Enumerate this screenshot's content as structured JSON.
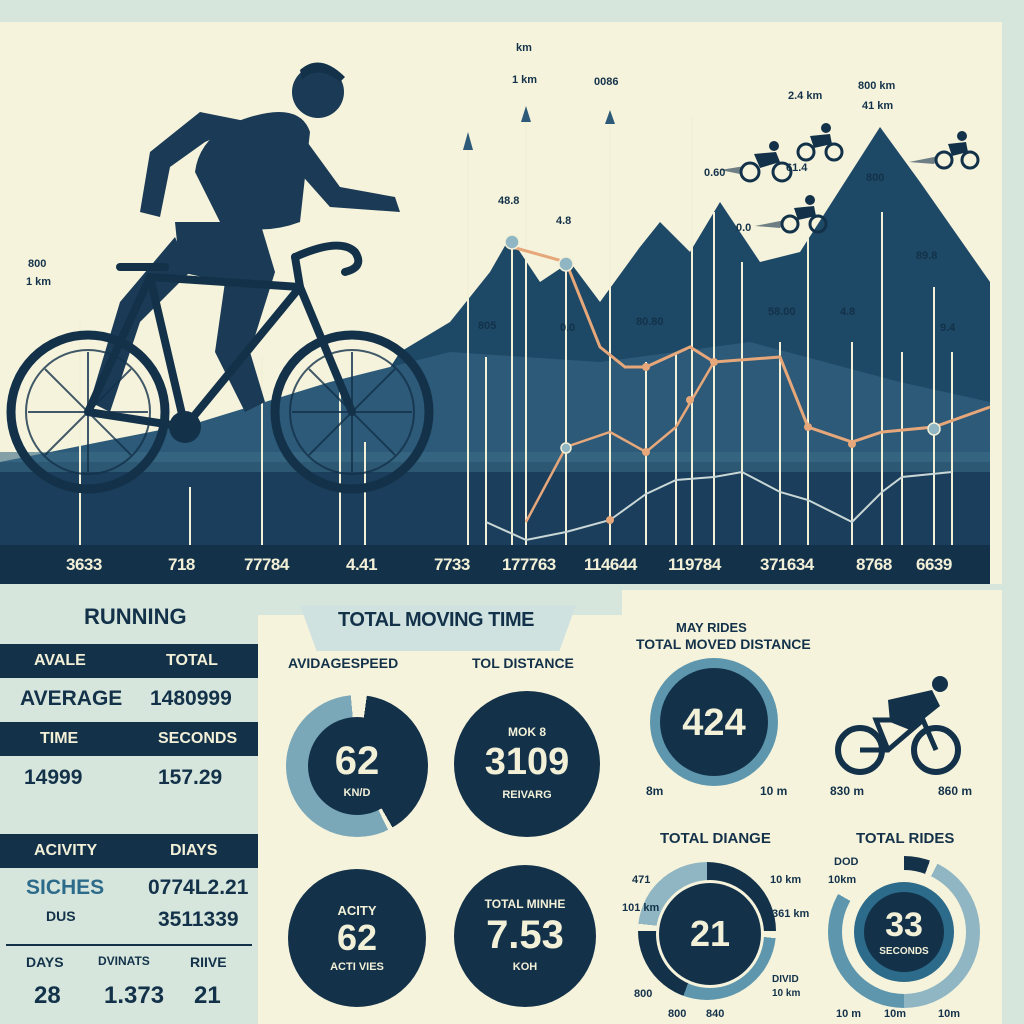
{
  "hero": {
    "left_note": [
      "800",
      "1 km"
    ],
    "ticks": [
      "3633",
      "718",
      "77784",
      "4.41",
      "7733",
      "177763",
      "114644",
      "119784",
      "371634",
      "8768",
      "6639"
    ],
    "peak_labels": [
      "km",
      "1 km",
      "0086",
      "2.4 km",
      "800 km",
      "41 km",
      "0.60",
      "61.4",
      "800",
      "48.8",
      "4.8",
      "0.0",
      "89.8",
      "80.80",
      "58.00",
      "4.8",
      "805",
      "0.0",
      "9.4"
    ]
  },
  "running": {
    "title": "RUNNING",
    "col1_header": "AVALE",
    "col2_header": "TOTAL",
    "row1_label": "AVERAGE",
    "row1_value": "1480999",
    "col3_header": "TIME",
    "col4_header": "SECONDS",
    "row2_label": "14999",
    "row2_value": "157.29"
  },
  "activity": {
    "col1_header": "ACIVITY",
    "col2_header": "DIAYS",
    "row1_label": "SICHES",
    "row1_value": "0774L2.21",
    "row2_label": "DUS",
    "row2_value": "3511339",
    "foot_labels": [
      "DAYS",
      "DVINATS",
      "RIIVE"
    ],
    "foot_values": [
      "28",
      "1.373",
      "21"
    ]
  },
  "moving": {
    "title": "TOTAL MOVING TIME",
    "label_speed": "AVIDAGESPEED",
    "label_distance": "TOL DISTANCE",
    "speed_value": "62",
    "speed_unit": "KN/D",
    "distance_top": "MOK 8",
    "distance_value": "3109",
    "distance_sub": "REIVARG",
    "activity_top": "ACITY",
    "activity_value": "62",
    "activity_sub": "ACTI VIES",
    "minutes_top": "TOTAL MINHE",
    "minutes_value": "7.53",
    "minutes_sub": "KOH"
  },
  "rides": {
    "title_line1": "MAY RIDES",
    "title_line2": "TOTAL MOVED DISTANCE",
    "big_value": "424",
    "left_small": "8m",
    "right_small": "10 m",
    "bike_left": "830 m",
    "bike_right": "860 m",
    "diag_title": "TOTAL DIANGE",
    "diag_value": "21",
    "diag_labels": [
      "471",
      "10 km",
      "101 km",
      "361 km",
      "DIVID",
      "10 km",
      "800",
      "800",
      "840"
    ],
    "rides_title": "TOTAL RIDES",
    "rides_value": "33",
    "rides_sub": "SECONDS",
    "rides_labels": [
      "DOD",
      "10km",
      "10 m",
      "10m",
      "10m"
    ]
  }
}
